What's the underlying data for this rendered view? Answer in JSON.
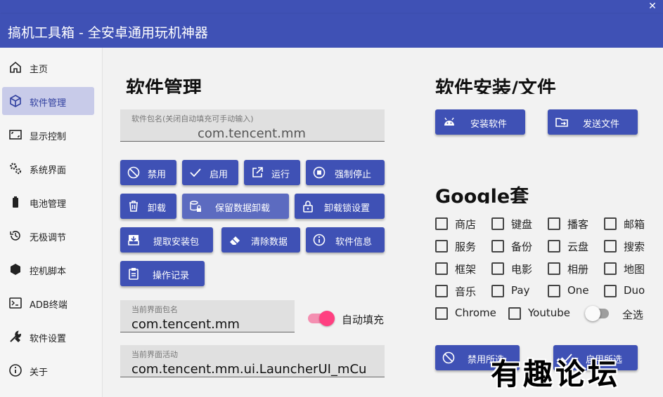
{
  "window": {
    "title": "搞机工具箱 - 全安卓通用玩机神器",
    "close_glyph": "✕"
  },
  "sidebar": {
    "items": [
      {
        "label": "主页",
        "icon": "home-icon"
      },
      {
        "label": "软件管理",
        "icon": "cube-icon",
        "active": true
      },
      {
        "label": "显示控制",
        "icon": "screen-icon"
      },
      {
        "label": "系统界面",
        "icon": "gears-icon"
      },
      {
        "label": "电池管理",
        "icon": "battery-icon"
      },
      {
        "label": "无极调节",
        "icon": "history-icon"
      },
      {
        "label": "控机脚本",
        "icon": "hexagon-icon"
      },
      {
        "label": "ADB终端",
        "icon": "terminal-icon"
      },
      {
        "label": "软件设置",
        "icon": "tools-icon"
      },
      {
        "label": "关于",
        "icon": "info-icon"
      }
    ]
  },
  "software": {
    "title": "软件管理",
    "package_hint": "软件包名(关闭自动填充可手动输入)",
    "package_value": "com.tencent.mm",
    "buttons": {
      "disable": "禁用",
      "enable": "启用",
      "run": "运行",
      "force_stop": "强制停止",
      "uninstall": "卸载",
      "keep_data_uninstall": "保留数据卸载",
      "uninstall_lock": "卸载锁设置",
      "extract_apk": "提取安装包",
      "clear_data": "清除数据",
      "app_info": "软件信息",
      "op_log": "操作记录"
    },
    "current_package_hint": "当前界面包名",
    "current_package_value": "com.tencent.mm",
    "auto_fill_label": "自动填充",
    "auto_fill_on": true,
    "current_activity_hint": "当前界面活动",
    "current_activity_value": "com.tencent.mm.ui.LauncherUI_mCu"
  },
  "install": {
    "title": "软件安装/文件",
    "install_label": "安装软件",
    "send_file_label": "发送文件"
  },
  "google": {
    "title": "Google套",
    "items": [
      "商店",
      "键盘",
      "播客",
      "邮箱",
      "服务",
      "备份",
      "云盘",
      "搜索",
      "框架",
      "电影",
      "相册",
      "地图",
      "音乐",
      "Pay",
      "One",
      "Duo",
      "Chrome",
      "Youtube"
    ],
    "select_all_label": "全选",
    "select_all_on": false,
    "disable_selected_label": "禁用所选",
    "enable_selected_label": "启用所选"
  },
  "watermark": "有趣论坛",
  "colors": {
    "primary": "#3f51b5",
    "accent": "#ff4081",
    "active_nav": "#c8cbe9"
  }
}
